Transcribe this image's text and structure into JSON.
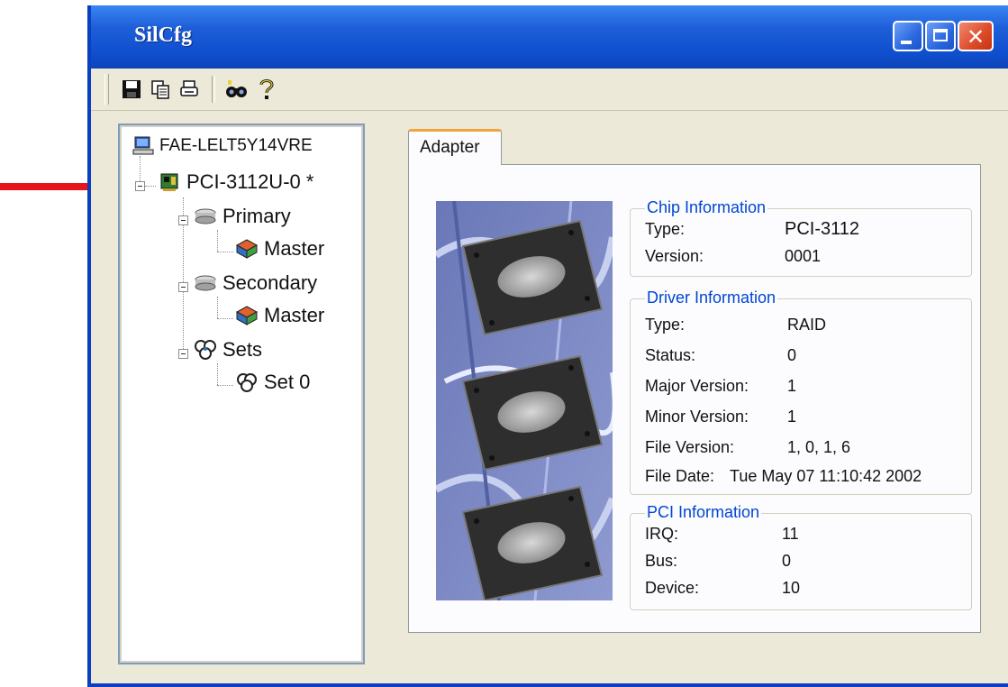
{
  "window": {
    "title": "SilCfg"
  },
  "toolbar": {
    "buttons": [
      {
        "icon": "save-icon"
      },
      {
        "icon": "copy-icon"
      },
      {
        "icon": "print-icon"
      },
      {
        "icon": "find-icon"
      },
      {
        "icon": "help-icon"
      }
    ]
  },
  "tree": {
    "root": "FAE-LELT5Y14VRE",
    "adapter": "PCI-3112U-0 *",
    "primary": "Primary",
    "primary_master": "Master",
    "secondary": "Secondary",
    "secondary_master": "Master",
    "sets": "Sets",
    "set0": "Set 0"
  },
  "tab": {
    "label": "Adapter"
  },
  "chip": {
    "legend": "Chip Information",
    "rows": [
      {
        "key": "Type:",
        "value": "PCI-3112"
      },
      {
        "key": "Version:",
        "value": "0001"
      }
    ]
  },
  "driver": {
    "legend": "Driver Information",
    "rows": [
      {
        "key": "Type:",
        "value": "RAID"
      },
      {
        "key": "Status:",
        "value": "0"
      },
      {
        "key": "Major Version:",
        "value": "1"
      },
      {
        "key": "Minor Version:",
        "value": "1"
      },
      {
        "key": "File Version:",
        "value": "1, 0, 1, 6"
      },
      {
        "key": "File Date:",
        "value": "Tue May 07 11:10:42 2002"
      }
    ]
  },
  "pci": {
    "legend": "PCI Information",
    "rows": [
      {
        "key": "IRQ:",
        "value": "11"
      },
      {
        "key": "Bus:",
        "value": "0"
      },
      {
        "key": "Device:",
        "value": "10"
      }
    ]
  },
  "colors": {
    "accent": "#0046d5",
    "titlebar": "#0f4fcf",
    "annotation": "#e8141b",
    "tab_highlight": "#f2a33a"
  }
}
